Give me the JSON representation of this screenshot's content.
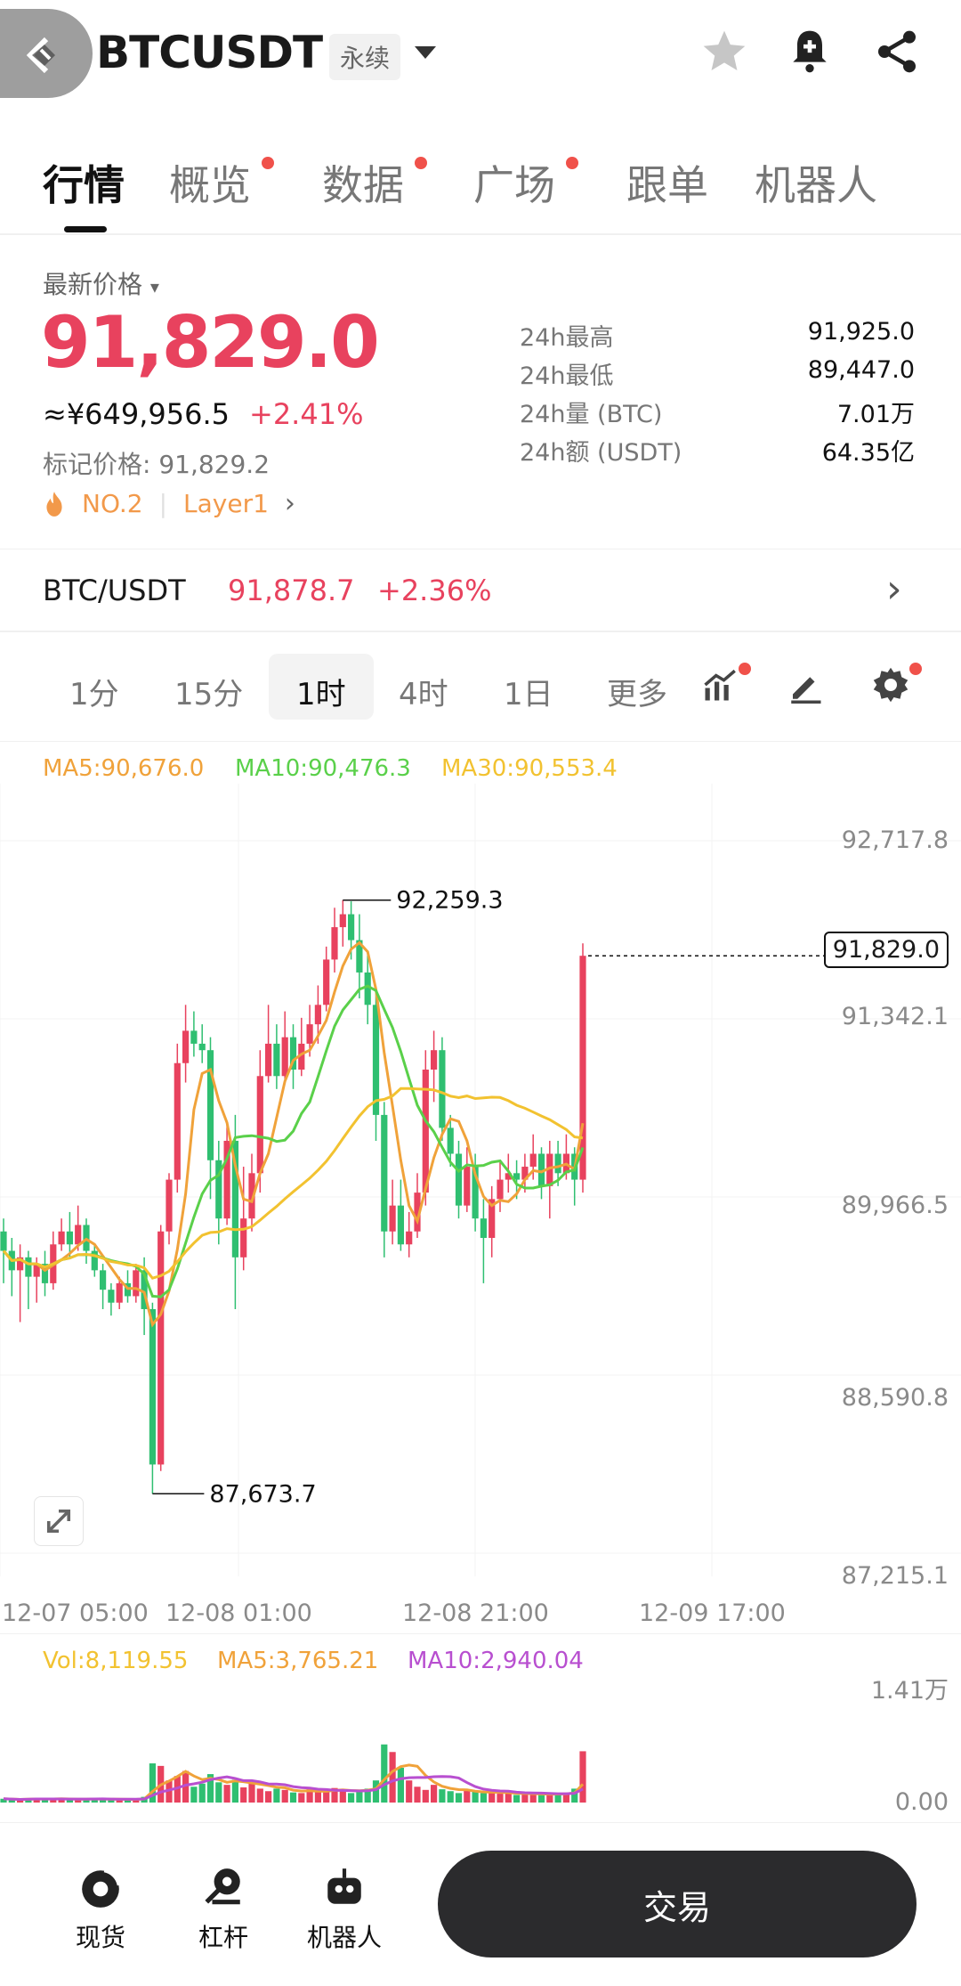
{
  "header": {
    "symbol": "BTCUSDT",
    "perp_tag": "永续"
  },
  "tabs": [
    {
      "label": "行情",
      "dot": false
    },
    {
      "label": "概览",
      "dot": true
    },
    {
      "label": "数据",
      "dot": true
    },
    {
      "label": "广场",
      "dot": true
    },
    {
      "label": "跟单",
      "dot": false
    },
    {
      "label": "机器人",
      "dot": false
    }
  ],
  "price": {
    "latest_label": "最新价格",
    "latest": "91,829.0",
    "cny": "≈¥649,956.5",
    "change": "+2.41%",
    "mark_label": "标记价格: 91,829.2",
    "rank": "NO.2",
    "sector": "Layer1"
  },
  "stats": [
    {
      "label": "24h最高",
      "value": "91,925.0"
    },
    {
      "label": "24h最低",
      "value": "89,447.0"
    },
    {
      "label": "24h量 (BTC)",
      "value": "7.01万"
    },
    {
      "label": "24h额 (USDT)",
      "value": "64.35亿"
    }
  ],
  "spot": {
    "pair": "BTC/USDT",
    "price": "91,878.7",
    "change": "+2.36%"
  },
  "intervals": [
    "1分",
    "15分",
    "1时",
    "4时",
    "1日",
    "更多"
  ],
  "active_interval": "1时",
  "ma": {
    "ma5": "MA5:90,676.0",
    "ma10": "MA10:90,476.3",
    "ma30": "MA30:90,553.4"
  },
  "vol": {
    "vol": "Vol:8,119.55",
    "ma5": "MA5:3,765.21",
    "ma10": "MA10:2,940.04",
    "max_label": "1.41万",
    "zero_label": "0.00"
  },
  "y_axis": [
    "92,717.8",
    "91,342.1",
    "89,966.5",
    "88,590.8",
    "87,215.1"
  ],
  "x_axis": [
    "12-07 05:00",
    "12-08 01:00",
    "12-08 21:00",
    "12-09 17:00"
  ],
  "annotations": {
    "high": "92,259.3",
    "low": "87,673.7",
    "current": "91,829.0"
  },
  "bottom_nav": [
    {
      "label": "现货",
      "icon": "coin-icon"
    },
    {
      "label": "杠杆",
      "icon": "leverage-icon"
    },
    {
      "label": "机器人",
      "icon": "robot-icon"
    }
  ],
  "trade_button": "交易",
  "colors": {
    "up": "#e8425e",
    "down": "#2fbf71",
    "ma5": "#f0a23a",
    "ma10": "#5ad04a",
    "ma30": "#f2c230",
    "vol_ma10": "#b84fd0"
  },
  "chart_data": {
    "type": "candlestick",
    "ylim": [
      87215.1,
      92717.8
    ],
    "x_ticks": [
      "12-07 05:00",
      "12-08 01:00",
      "12-08 21:00",
      "12-09 17:00"
    ],
    "candles": [
      [
        89700,
        89550,
        89800,
        89300
      ],
      [
        89550,
        89400,
        89650,
        89200
      ],
      [
        89400,
        89500,
        89600,
        89000
      ],
      [
        89500,
        89350,
        89550,
        89100
      ],
      [
        89350,
        89450,
        89500,
        89150
      ],
      [
        89450,
        89300,
        89550,
        89200
      ],
      [
        89300,
        89600,
        89700,
        89250
      ],
      [
        89600,
        89700,
        89800,
        89550
      ],
      [
        89700,
        89600,
        89850,
        89500
      ],
      [
        89600,
        89750,
        89900,
        89550
      ],
      [
        89750,
        89550,
        89800,
        89450
      ],
      [
        89550,
        89400,
        89600,
        89350
      ],
      [
        89400,
        89250,
        89450,
        89100
      ],
      [
        89250,
        89150,
        89300,
        89050
      ],
      [
        89150,
        89300,
        89350,
        89100
      ],
      [
        89300,
        89200,
        89400,
        89150
      ],
      [
        89200,
        89400,
        89450,
        89150
      ],
      [
        89400,
        89100,
        89500,
        88900
      ],
      [
        89100,
        87900,
        89150,
        87674
      ],
      [
        87900,
        89700,
        89750,
        87850
      ],
      [
        89700,
        90100,
        90150,
        89600
      ],
      [
        90100,
        91000,
        91150,
        90000
      ],
      [
        91000,
        91250,
        91450,
        90850
      ],
      [
        91250,
        91150,
        91400,
        91050
      ],
      [
        91150,
        91100,
        91300,
        91000
      ],
      [
        91100,
        90250,
        91200,
        89950
      ],
      [
        90250,
        89800,
        90400,
        89600
      ],
      [
        89800,
        90400,
        90550,
        89750
      ],
      [
        90400,
        89500,
        90600,
        89100
      ],
      [
        89500,
        89800,
        90200,
        89400
      ],
      [
        89800,
        90150,
        90300,
        89700
      ],
      [
        90150,
        90900,
        91100,
        90000
      ],
      [
        90900,
        91150,
        91450,
        90850
      ],
      [
        91150,
        90900,
        91300,
        90800
      ],
      [
        90900,
        91200,
        91400,
        90850
      ],
      [
        91200,
        90950,
        91300,
        90800
      ],
      [
        90950,
        91150,
        91350,
        90900
      ],
      [
        91150,
        91300,
        91450,
        91050
      ],
      [
        91300,
        91450,
        91600,
        91150
      ],
      [
        91450,
        91800,
        91900,
        91400
      ],
      [
        91800,
        92050,
        92200,
        91700
      ],
      [
        92050,
        92150,
        92259,
        91900
      ],
      [
        92150,
        91950,
        92250,
        91800
      ],
      [
        91950,
        91700,
        92150,
        91500
      ],
      [
        91700,
        91450,
        91850,
        91300
      ],
      [
        91450,
        90600,
        91550,
        90400
      ],
      [
        90600,
        89700,
        90700,
        89500
      ],
      [
        89700,
        89900,
        90100,
        89600
      ],
      [
        89900,
        89600,
        90100,
        89550
      ],
      [
        89600,
        89700,
        89850,
        89500
      ],
      [
        89700,
        90000,
        90150,
        89650
      ],
      [
        90000,
        90950,
        91100,
        89900
      ],
      [
        90950,
        91100,
        91250,
        90700
      ],
      [
        91100,
        90500,
        91200,
        90400
      ],
      [
        90500,
        90300,
        90600,
        90200
      ],
      [
        90300,
        89900,
        90400,
        89800
      ],
      [
        89900,
        90200,
        90350,
        89850
      ],
      [
        90200,
        89800,
        90300,
        89700
      ],
      [
        89800,
        89650,
        89950,
        89300
      ],
      [
        89650,
        89950,
        90050,
        89500
      ],
      [
        89950,
        90100,
        90250,
        89850
      ],
      [
        90100,
        90150,
        90300,
        90000
      ],
      [
        90150,
        90100,
        90250,
        89950
      ],
      [
        90100,
        90200,
        90300,
        90000
      ],
      [
        90200,
        90300,
        90450,
        90100
      ],
      [
        90300,
        90050,
        90350,
        89950
      ],
      [
        90050,
        90300,
        90400,
        89800
      ],
      [
        90300,
        90150,
        90400,
        90050
      ],
      [
        90150,
        90300,
        90450,
        90100
      ],
      [
        90300,
        90100,
        90350,
        89900
      ],
      [
        90100,
        91829,
        91925,
        90000
      ]
    ],
    "volume": [
      600,
      500,
      400,
      650,
      700,
      500,
      600,
      550,
      450,
      500,
      600,
      700,
      500,
      400,
      450,
      500,
      600,
      900,
      6200,
      5800,
      3500,
      4200,
      5000,
      2500,
      3000,
      4500,
      3200,
      2800,
      3600,
      2400,
      3500,
      2200,
      1800,
      2200,
      2000,
      1600,
      1500,
      2100,
      1800,
      1900,
      2300,
      2000,
      1500,
      1700,
      2200,
      3500,
      9200,
      8000,
      5500,
      3500,
      2500,
      2000,
      2800,
      2100,
      1800,
      1500,
      1900,
      1700,
      1500,
      1600,
      1400,
      1600,
      1200,
      1300,
      1500,
      1200,
      1400,
      1300,
      1500,
      2200,
      8120
    ]
  }
}
